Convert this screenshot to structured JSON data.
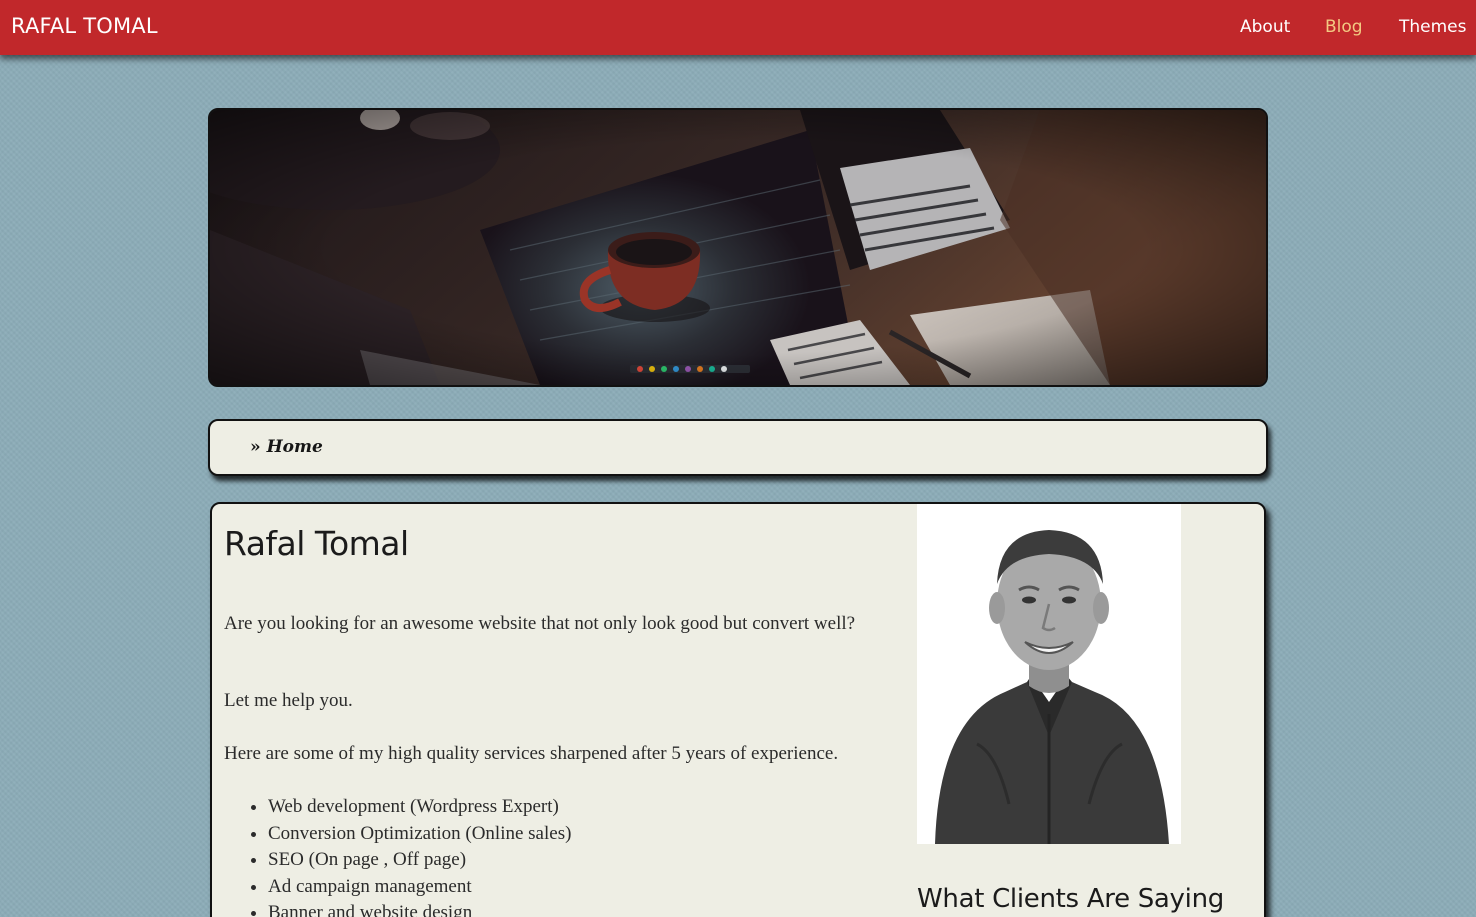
{
  "header": {
    "brand": "RAFAL TOMAL",
    "nav": [
      {
        "label": "About",
        "active": false
      },
      {
        "label": "Blog",
        "active": true
      },
      {
        "label": "Themes",
        "active": false
      }
    ]
  },
  "breadcrumb": {
    "separator": "»",
    "items": [
      "Home"
    ]
  },
  "content": {
    "title": "Rafal Tomal",
    "paragraphs": [
      "Are you looking for an awesome website that not only look good but convert well?",
      "Let me help you.",
      "Here are some of my high quality services sharpened after 5 years of experience."
    ],
    "services": [
      "Web development (Wordpress Expert)",
      "Conversion Optimization (Online sales)",
      "SEO (On page , Off page)",
      "Ad campaign management",
      "Banner and website design"
    ]
  },
  "sidebar": {
    "heading": "What Clients Are Saying"
  },
  "colors": {
    "topbar": "#c1282b",
    "nav_active": "#f3c982",
    "page_background": "#8cacb8",
    "panel_background": "#eeeee4"
  }
}
